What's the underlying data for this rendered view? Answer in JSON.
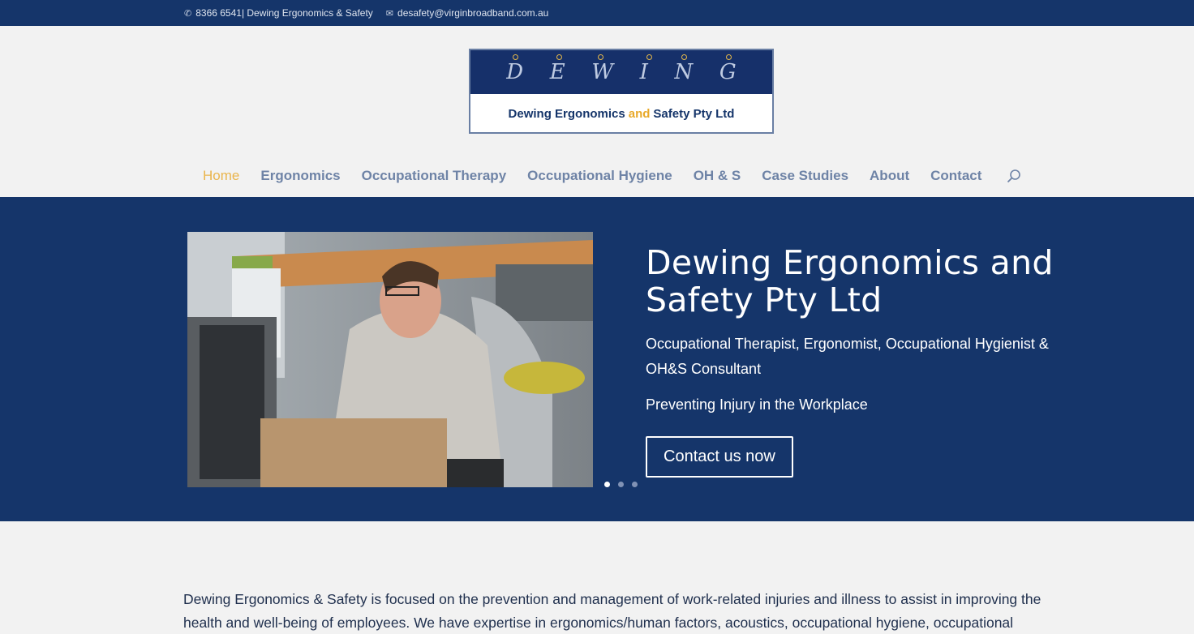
{
  "topbar": {
    "phone": "8366 6541| Dewing Ergonomics & Safety",
    "email": "desafety@virginbroadband.com.au"
  },
  "logo": {
    "letters": [
      "D",
      "E",
      "W",
      "I",
      "N",
      "G"
    ],
    "name_part1": "Dewing Ergonomics",
    "name_and": "and",
    "name_part2": "Safety Pty Ltd"
  },
  "nav": {
    "items": [
      "Home",
      "Ergonomics",
      "Occupational Therapy",
      "Occupational Hygiene",
      "OH & S",
      "Case Studies",
      "About",
      "Contact"
    ]
  },
  "hero": {
    "title": "Dewing Ergonomics and Safety Pty Ltd",
    "subtitle": "Occupational Therapist, Ergonomist, Occupational Hygienist & OH&S Consultant",
    "tagline": "Preventing Injury in the Workplace",
    "button": "Contact us now",
    "slide_count": 3,
    "active_slide": 1
  },
  "content": {
    "intro": "Dewing Ergonomics & Safety is focused on the prevention and management of work-related injuries and illness to assist in improving the health and well-being of employees.  We have expertise in ergonomics/human factors, acoustics, occupational hygiene, occupational"
  },
  "colors": {
    "navy": "#15356a",
    "accent": "#eab54d",
    "nav_link": "#6e83a6"
  }
}
